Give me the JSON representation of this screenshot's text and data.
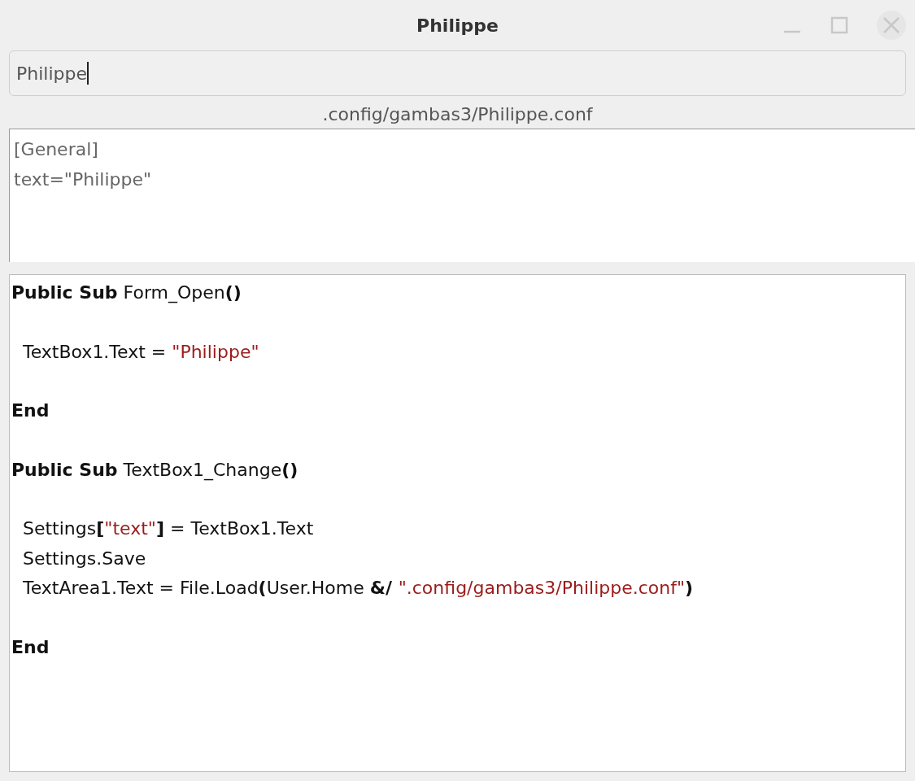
{
  "window": {
    "title": "Philippe"
  },
  "text_field": {
    "value": "Philippe",
    "focused": true
  },
  "path_label": ".config/gambas3/Philippe.conf",
  "text_area": {
    "lines": [
      "[General]",
      "text=\"Philippe\""
    ]
  },
  "code_editor": {
    "lines": [
      {
        "kind": "code",
        "tokens": [
          {
            "kind": "keyword",
            "text": "Public Sub"
          },
          {
            "kind": "plain",
            "text": " Form_Open"
          },
          {
            "kind": "operator",
            "text": "()"
          }
        ]
      },
      {
        "kind": "blank"
      },
      {
        "kind": "code",
        "tokens": [
          {
            "kind": "plain",
            "text": "  TextBox1.Text = "
          },
          {
            "kind": "string",
            "text": "\"Philippe\""
          }
        ]
      },
      {
        "kind": "blank"
      },
      {
        "kind": "code",
        "tokens": [
          {
            "kind": "keyword",
            "text": "End"
          }
        ]
      },
      {
        "kind": "blank"
      },
      {
        "kind": "code",
        "tokens": [
          {
            "kind": "keyword",
            "text": "Public Sub"
          },
          {
            "kind": "plain",
            "text": " TextBox1_Change"
          },
          {
            "kind": "operator",
            "text": "()"
          }
        ]
      },
      {
        "kind": "blank"
      },
      {
        "kind": "code",
        "tokens": [
          {
            "kind": "plain",
            "text": "  Settings"
          },
          {
            "kind": "operator",
            "text": "["
          },
          {
            "kind": "string",
            "text": "\"text\""
          },
          {
            "kind": "operator",
            "text": "]"
          },
          {
            "kind": "plain",
            "text": " = TextBox1.Text"
          }
        ]
      },
      {
        "kind": "code",
        "tokens": [
          {
            "kind": "plain",
            "text": "  Settings.Save"
          }
        ]
      },
      {
        "kind": "code",
        "tokens": [
          {
            "kind": "plain",
            "text": "  TextArea1.Text = File.Load"
          },
          {
            "kind": "operator",
            "text": "("
          },
          {
            "kind": "plain",
            "text": "User.Home "
          },
          {
            "kind": "operator",
            "text": "&/ "
          },
          {
            "kind": "string",
            "text": "\".config/gambas3/Philippe.conf\""
          },
          {
            "kind": "operator",
            "text": ")"
          }
        ]
      },
      {
        "kind": "blank"
      },
      {
        "kind": "code",
        "tokens": [
          {
            "kind": "keyword",
            "text": "End"
          }
        ]
      }
    ]
  }
}
